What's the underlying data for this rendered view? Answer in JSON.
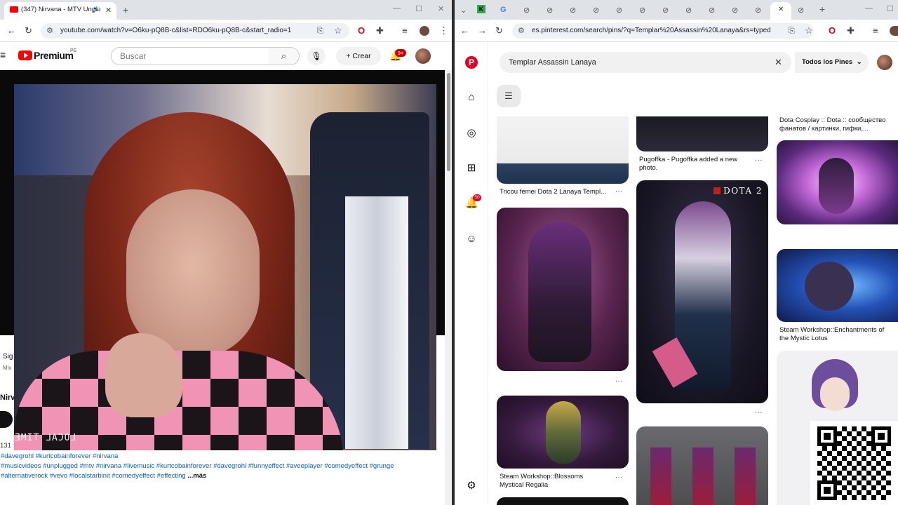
{
  "left_browser": {
    "tab_title": "(347) Nirvana - MTV Unplu",
    "url": "youtube.com/watch?v=O6ku-pQ8B-c&list=RDO6ku-pQ8B-c&start_radio=1"
  },
  "youtube": {
    "brand": "Premium",
    "region": "PE",
    "search_placeholder": "Buscar",
    "create_label": "Crear",
    "notif_count": "9+",
    "video_overlay": "LOCAL TIME",
    "sidebar_sig": "Sig",
    "sidebar_mix": "Mix",
    "sidebar_title": "Nirva",
    "sidebar_num": "131",
    "tags_line1": "#davegrohl #kurtcobainforever #nirvana",
    "tags_line2": "#musicvideos #unplugged #mtv #nirvana #livemusic #kurtcobainforever #davegrohl #funnyeffect #aveeplayer #comedyeffect #grunge",
    "tags_line3": "#alternativerock #vevo #localstarbinit #comedyeffect #effecting",
    "more_label": "...más"
  },
  "right_browser": {
    "url": "es.pinterest.com/search/pins/?q=Templar%20Assassin%20Lanaya&rs=typed"
  },
  "pinterest": {
    "search_value": "Templar Assassin Lanaya",
    "filter_label": "Todos los Pines",
    "notif_count": "50",
    "dota_logo": "DOTA 2",
    "captions": {
      "col1_top": "Tricou femei Dota 2 Lanaya Templ...",
      "col1_bottom": "Steam Workshop::Blossoms Mystical Regalia",
      "col2_top": "Pugoffka - Pugoffka added a new photo.",
      "col3_top": "Dota Cosplay :: Dota :: сообщество фанатов / картинки, гифки,...",
      "col3_mid": "Steam Workshop::Enchantments of the Mystic Lotus"
    },
    "more_dots": "..."
  },
  "icons": {
    "close": "✕",
    "back": "←",
    "forward": "→",
    "reload": "↻",
    "star": "☆",
    "search": "⌕",
    "mic": "🎙",
    "plus": "+",
    "bell": "🔔",
    "home": "⌂",
    "compass": "◎",
    "add": "⊞",
    "chat": "☺",
    "gear": "⚙",
    "tune": "☰",
    "chevron": "⌄",
    "minimize": "—",
    "maximize": "☐"
  }
}
